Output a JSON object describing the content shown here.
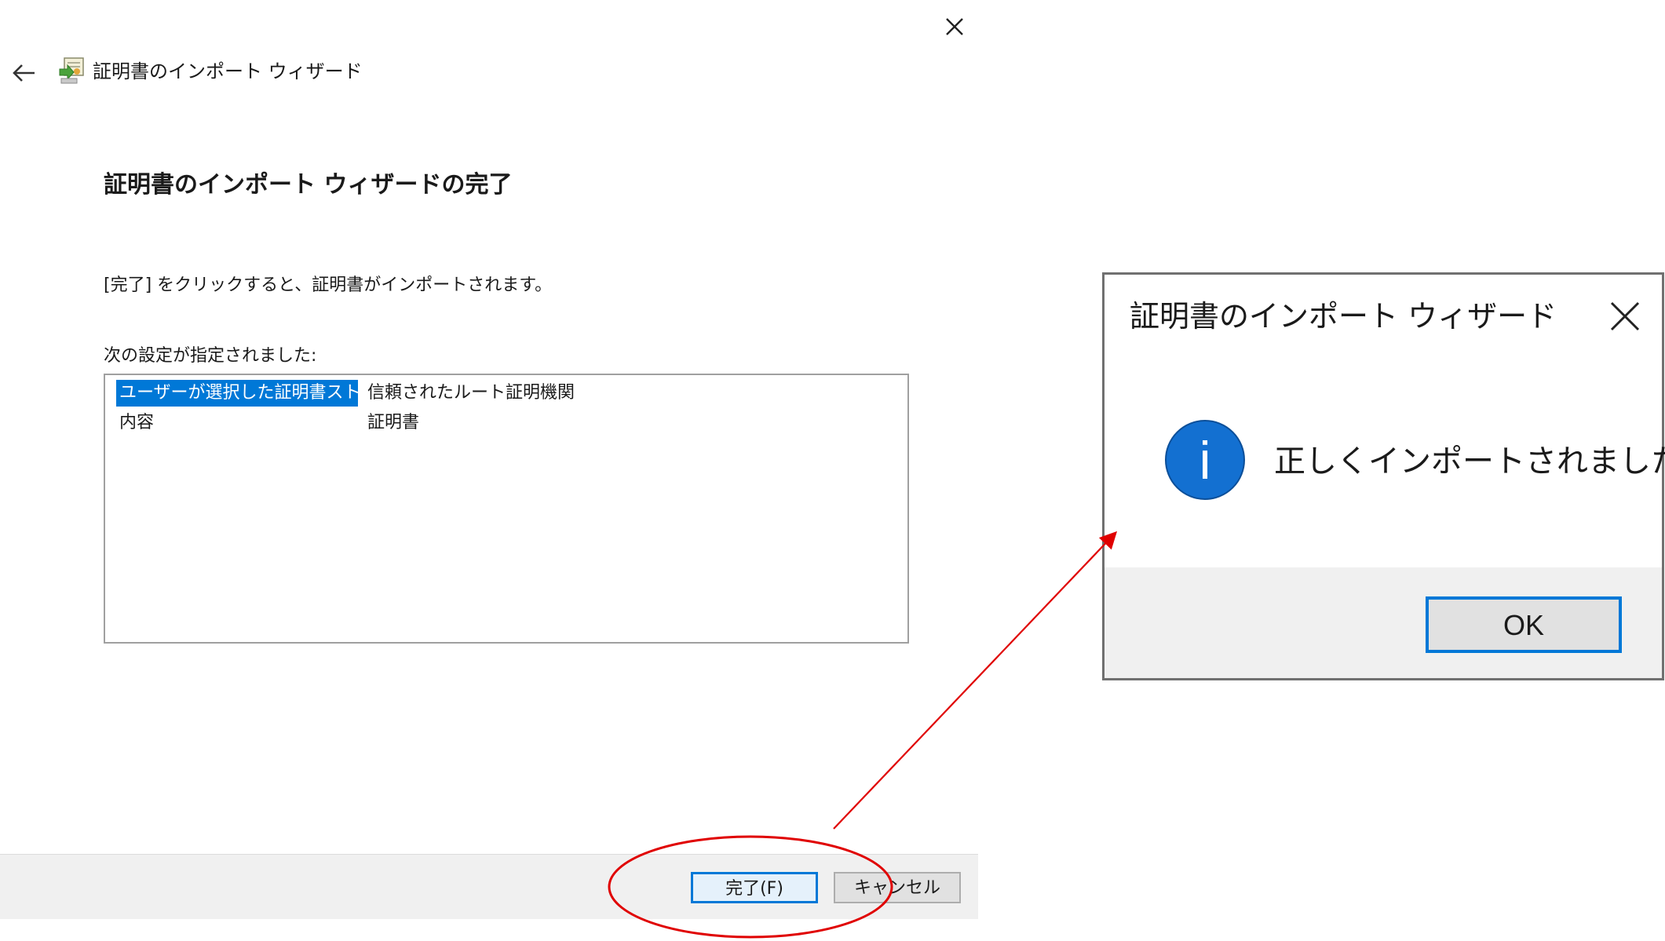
{
  "wizard": {
    "title": "証明書のインポート ウィザード",
    "heading": "証明書のインポート ウィザードの完了",
    "instruction": "[完了] をクリックすると、証明書がインポートされます。",
    "settings_label": "次の設定が指定されました:",
    "settings": [
      {
        "key": "ユーザーが選択した証明書ストア",
        "value": "信頼されたルート証明機関",
        "selected": true
      },
      {
        "key": "内容",
        "value": "証明書",
        "selected": false
      }
    ],
    "buttons": {
      "finish": "完了(F)",
      "cancel": "キャンセル"
    }
  },
  "message_box": {
    "title": "証明書のインポート ウィザード",
    "message": "正しくインポートされました。",
    "info_icon_glyph": "i",
    "ok_label": "OK"
  },
  "icons": {
    "close": "close-icon",
    "back": "back-arrow-icon",
    "wizard": "certificate-wizard-icon",
    "info": "info-icon"
  },
  "colors": {
    "accent": "#0078d7",
    "selection": "#0078d7",
    "annotation": "#e00000",
    "footer_bg": "#f0f0f0"
  }
}
